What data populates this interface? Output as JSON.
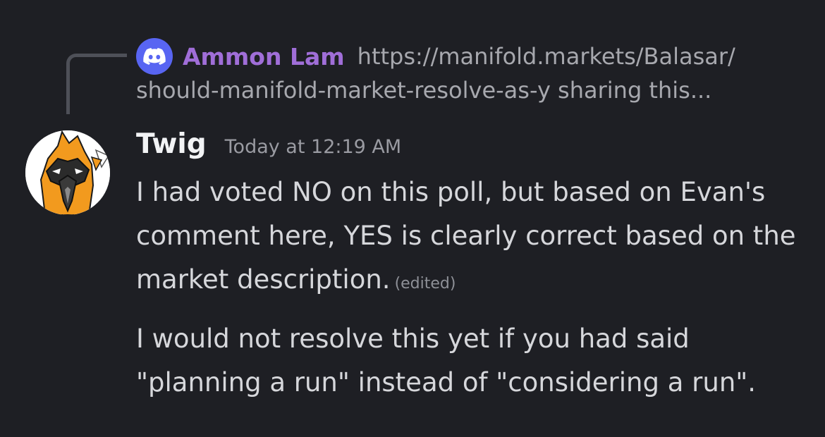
{
  "reply": {
    "author": "Ammon Lam",
    "line1": "https://manifold.markets/Balasar/",
    "line2": "should-manifold-market-resolve-as-y  sharing this...",
    "icon": "discord-logo-icon",
    "author_color": "#a06ed8"
  },
  "message": {
    "author": "Twig",
    "timestamp": "Today at 12:19 AM",
    "paragraph1": "I had voted NO on this poll, but based on Evan's comment here, YES is clearly correct based on the market description.",
    "edited": "(edited)",
    "paragraph2": "I would not resolve this yet if you had said \"planning a run\" instead of \"considering a run\"."
  },
  "colors": {
    "background": "#1e1f24",
    "discord_blurple": "#5865f2"
  }
}
